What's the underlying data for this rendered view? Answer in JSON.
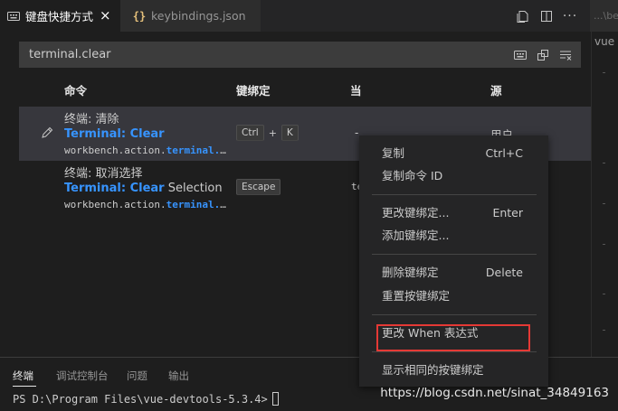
{
  "tabs": [
    {
      "label": "键盘快捷方式",
      "close": "×"
    },
    {
      "label": "keybindings.json"
    }
  ],
  "tab_actions": {
    "more": "···"
  },
  "split_hint": "...\\be",
  "split_crumb": "vue",
  "search": {
    "value": "terminal.clear"
  },
  "table": {
    "headers": {
      "command": "命令",
      "keybinding": "键绑定",
      "when": "当",
      "source": "源"
    },
    "rows": [
      {
        "title": "终端: 清除",
        "label_highlight": "Terminal: Clear",
        "label_rest": "",
        "id_prefix": "workbench.action.",
        "id_highlight": "terminal.",
        "id_suffix": "…",
        "keys": [
          "Ctrl",
          "K"
        ],
        "plus": "+",
        "when": "-",
        "source": "用户"
      },
      {
        "title": "终端: 取消选择",
        "label_highlight": "Terminal: Clear",
        "label_rest": " Selection",
        "id_prefix": "workbench.action.",
        "id_highlight": "terminal.",
        "id_suffix": "…",
        "keys": [
          "Escape"
        ],
        "when": "te"
      }
    ]
  },
  "context_menu": {
    "items": [
      {
        "label": "复制",
        "key": "Ctrl+C"
      },
      {
        "label": "复制命令 ID",
        "key": ""
      },
      {
        "label": "更改键绑定...",
        "key": "Enter"
      },
      {
        "label": "添加键绑定...",
        "key": ""
      },
      {
        "label": "删除键绑定",
        "key": "Delete"
      },
      {
        "label": "重置按键绑定",
        "key": ""
      },
      {
        "label": "更改 When 表达式",
        "key": ""
      },
      {
        "label": "显示相同的按键绑定",
        "key": ""
      }
    ]
  },
  "panel": {
    "tabs": [
      "终端",
      "调试控制台",
      "问题",
      "输出"
    ],
    "terminal_prompt": "PS D:\\Program Files\\vue-devtools-5.3.4>"
  },
  "watermark": "https://blog.csdn.net/sinat_34849163",
  "colors": {
    "accent": "#3794ff",
    "highlight_box": "#e53935",
    "selected_row": "#37373d"
  }
}
